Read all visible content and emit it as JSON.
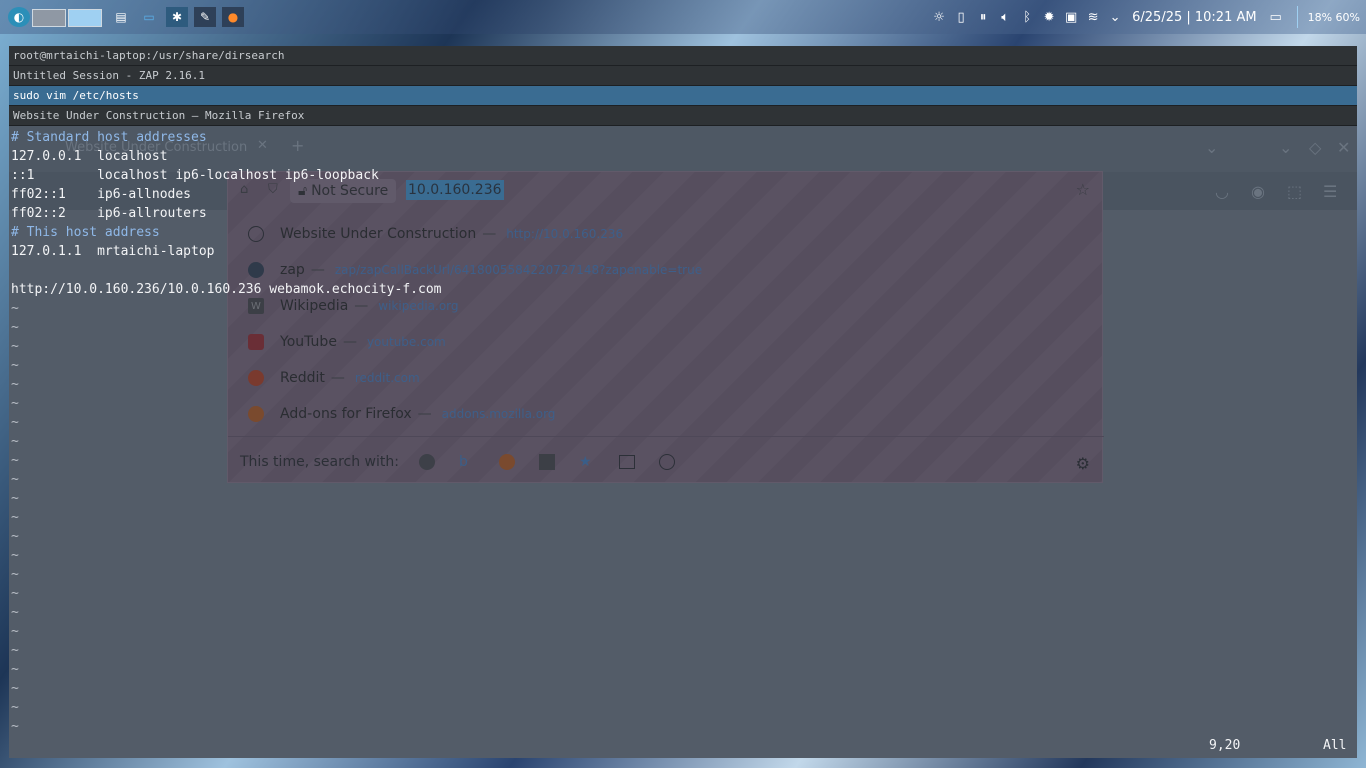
{
  "taskbar": {
    "clock": "6/25/25 | 10:21 AM",
    "battery": "18% 60%"
  },
  "window_tabs": [
    "root@mrtaichi-laptop:/usr/share/dirsearch",
    "Untitled Session - ZAP 2.16.1",
    "sudo vim /etc/hosts",
    "Website Under Construction — Mozilla Firefox"
  ],
  "firefox": {
    "tab_title": "Website Under Construction",
    "not_secure": "Not Secure",
    "url": "10.0.160.236",
    "suggestions": [
      {
        "title": "Website Under Construction",
        "url": "http://10.0.160.236",
        "icon": "globe-icon"
      },
      {
        "title": "zap",
        "url": "zap/zapCallBackUrl/6418005584220727148?zapenable=true",
        "icon": "zap-icon"
      },
      {
        "title": "Wikipedia",
        "url": "wikipedia.org",
        "icon": "wikipedia-icon"
      },
      {
        "title": "YouTube",
        "url": "youtube.com",
        "icon": "youtube-icon"
      },
      {
        "title": "Reddit",
        "url": "reddit.com",
        "icon": "reddit-icon"
      },
      {
        "title": "Add-ons for Firefox",
        "url": "addons.mozilla.org",
        "icon": "firefox-icon"
      }
    ],
    "search_with": "This time, search with:"
  },
  "vim": {
    "lines": [
      "# Standard host addresses",
      "127.0.0.1  localhost",
      "::1        localhost ip6-localhost ip6-loopback",
      "ff02::1    ip6-allnodes",
      "ff02::2    ip6-allrouters",
      "# This host address",
      "127.0.1.1  mrtaichi-laptop",
      "",
      "http://10.0.160.236/10.0.160.236 webamok.echocity-f.com"
    ],
    "tilde": "~",
    "position": "9,20",
    "scroll": "All"
  }
}
